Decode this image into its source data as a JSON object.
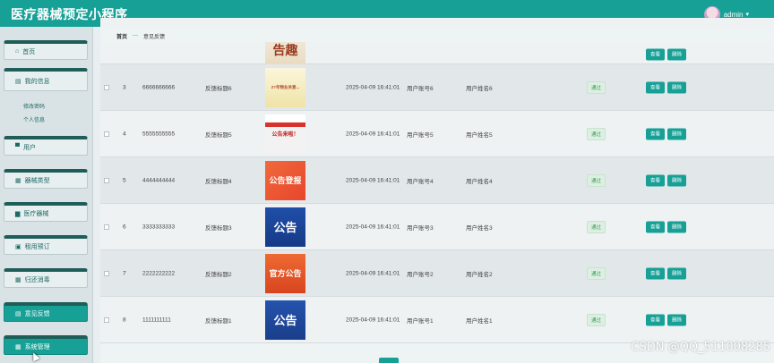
{
  "app": {
    "title": "医疗器械预定小程序",
    "user": "admin"
  },
  "breadcrumb": {
    "home": "首页",
    "separator": "—",
    "current": "意见反馈"
  },
  "sidebar": {
    "items": [
      {
        "label": "首页",
        "icon": "home-icon",
        "glyph": "⌂"
      },
      {
        "label": "我的信息",
        "icon": "profile-icon",
        "glyph": "▤"
      },
      {
        "label": "用户",
        "icon": "user-icon",
        "glyph": "▀"
      },
      {
        "label": "器械类型",
        "icon": "grid-icon",
        "glyph": "▦"
      },
      {
        "label": "医疗器械",
        "icon": "box-icon",
        "glyph": "▆"
      },
      {
        "label": "租用预订",
        "icon": "calendar-icon",
        "glyph": "▣"
      },
      {
        "label": "归还消毒",
        "icon": "grid-icon",
        "glyph": "▦"
      },
      {
        "label": "意见反馈",
        "icon": "feedback-icon",
        "glyph": "▤"
      },
      {
        "label": "系统管理",
        "icon": "grid-icon",
        "glyph": "▦"
      }
    ],
    "sub_items": [
      "修改密码",
      "个人信息"
    ]
  },
  "table": {
    "rows": [
      {
        "idx": "3",
        "account": "6666666666",
        "title": "反馈标题6",
        "thumb_text": "2?年物业关爱...",
        "time": "2025-04-09 16:41:01",
        "user_account": "用户账号6",
        "user_name": "用户姓名6",
        "status": "通过"
      },
      {
        "idx": "4",
        "account": "5555555555",
        "title": "反馈标题5",
        "thumb_text": "公告来啦！",
        "time": "2025-04-09 16:41:01",
        "user_account": "用户账号5",
        "user_name": "用户姓名5",
        "status": "通过"
      },
      {
        "idx": "5",
        "account": "4444444444",
        "title": "反馈标题4",
        "thumb_text": "公告登报",
        "time": "2025-04-09 16:41:01",
        "user_account": "用户账号4",
        "user_name": "用户姓名4",
        "status": "通过"
      },
      {
        "idx": "6",
        "account": "3333333333",
        "title": "反馈标题3",
        "thumb_text": "公告",
        "time": "2025-04-09 16:41:01",
        "user_account": "用户账号3",
        "user_name": "用户姓名3",
        "status": "通过"
      },
      {
        "idx": "7",
        "account": "2222222222",
        "title": "反馈标题2",
        "thumb_text": "官方公告",
        "time": "2025-04-09 16:41:01",
        "user_account": "用户账号2",
        "user_name": "用户姓名2",
        "status": "通过"
      },
      {
        "idx": "8",
        "account": "1111111111",
        "title": "反馈标题1",
        "thumb_text": "公告",
        "time": "2025-04-09 16:41:01",
        "user_account": "用户账号1",
        "user_name": "用户姓名1",
        "status": "通过"
      }
    ],
    "actions": {
      "view": "查看",
      "delete": "删除"
    }
  },
  "watermark": "CSDN @QQ_511008285",
  "colors": {
    "primary": "#17a096",
    "sidebar_bg": "#d9e3e6",
    "status_green": "#3c9b5a"
  }
}
